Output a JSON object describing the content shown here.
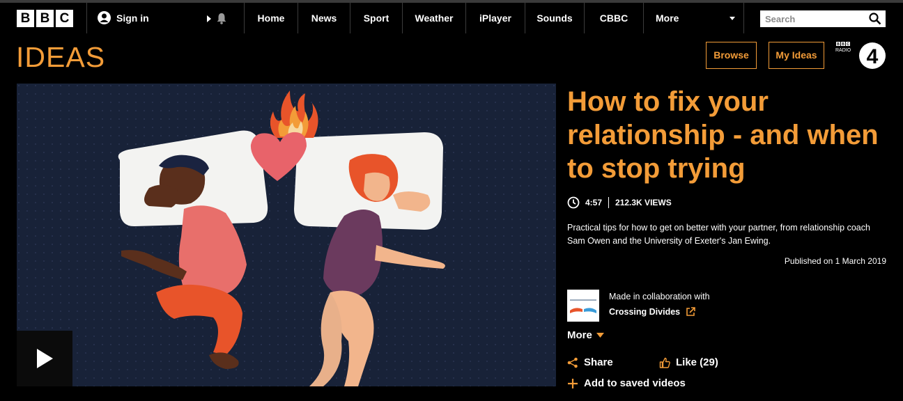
{
  "topbar": {
    "logo_letters": [
      "B",
      "B",
      "C"
    ],
    "signin_label": "Sign in",
    "nav": [
      "Home",
      "News",
      "Sport",
      "Weather",
      "iPlayer",
      "Sounds",
      "CBBC",
      "More"
    ],
    "search_placeholder": "Search"
  },
  "header": {
    "brand": "IDEAS",
    "browse_label": "Browse",
    "my_ideas_label": "My Ideas",
    "radio_logo_top": "BBC",
    "radio_logo_text": "RADIO",
    "radio_logo_number": "4"
  },
  "video": {
    "play_icon": "play-icon"
  },
  "article": {
    "title": "How to fix your relationship - and when to stop trying",
    "duration": "4:57",
    "views": "212.3K VIEWS",
    "description": "Practical tips for how to get on better with your partner, from relationship coach Sam Owen and the University of Exeter's Jan Ewing.",
    "published": "Published on 1 March 2019",
    "collab_intro": "Made in collaboration with",
    "collab_partner": "Crossing Divides",
    "more_label": "More",
    "share_label": "Share",
    "like_label": "Like (29)",
    "save_label": "Add to saved videos"
  },
  "colors": {
    "accent": "#f39c38",
    "background": "#000000"
  }
}
